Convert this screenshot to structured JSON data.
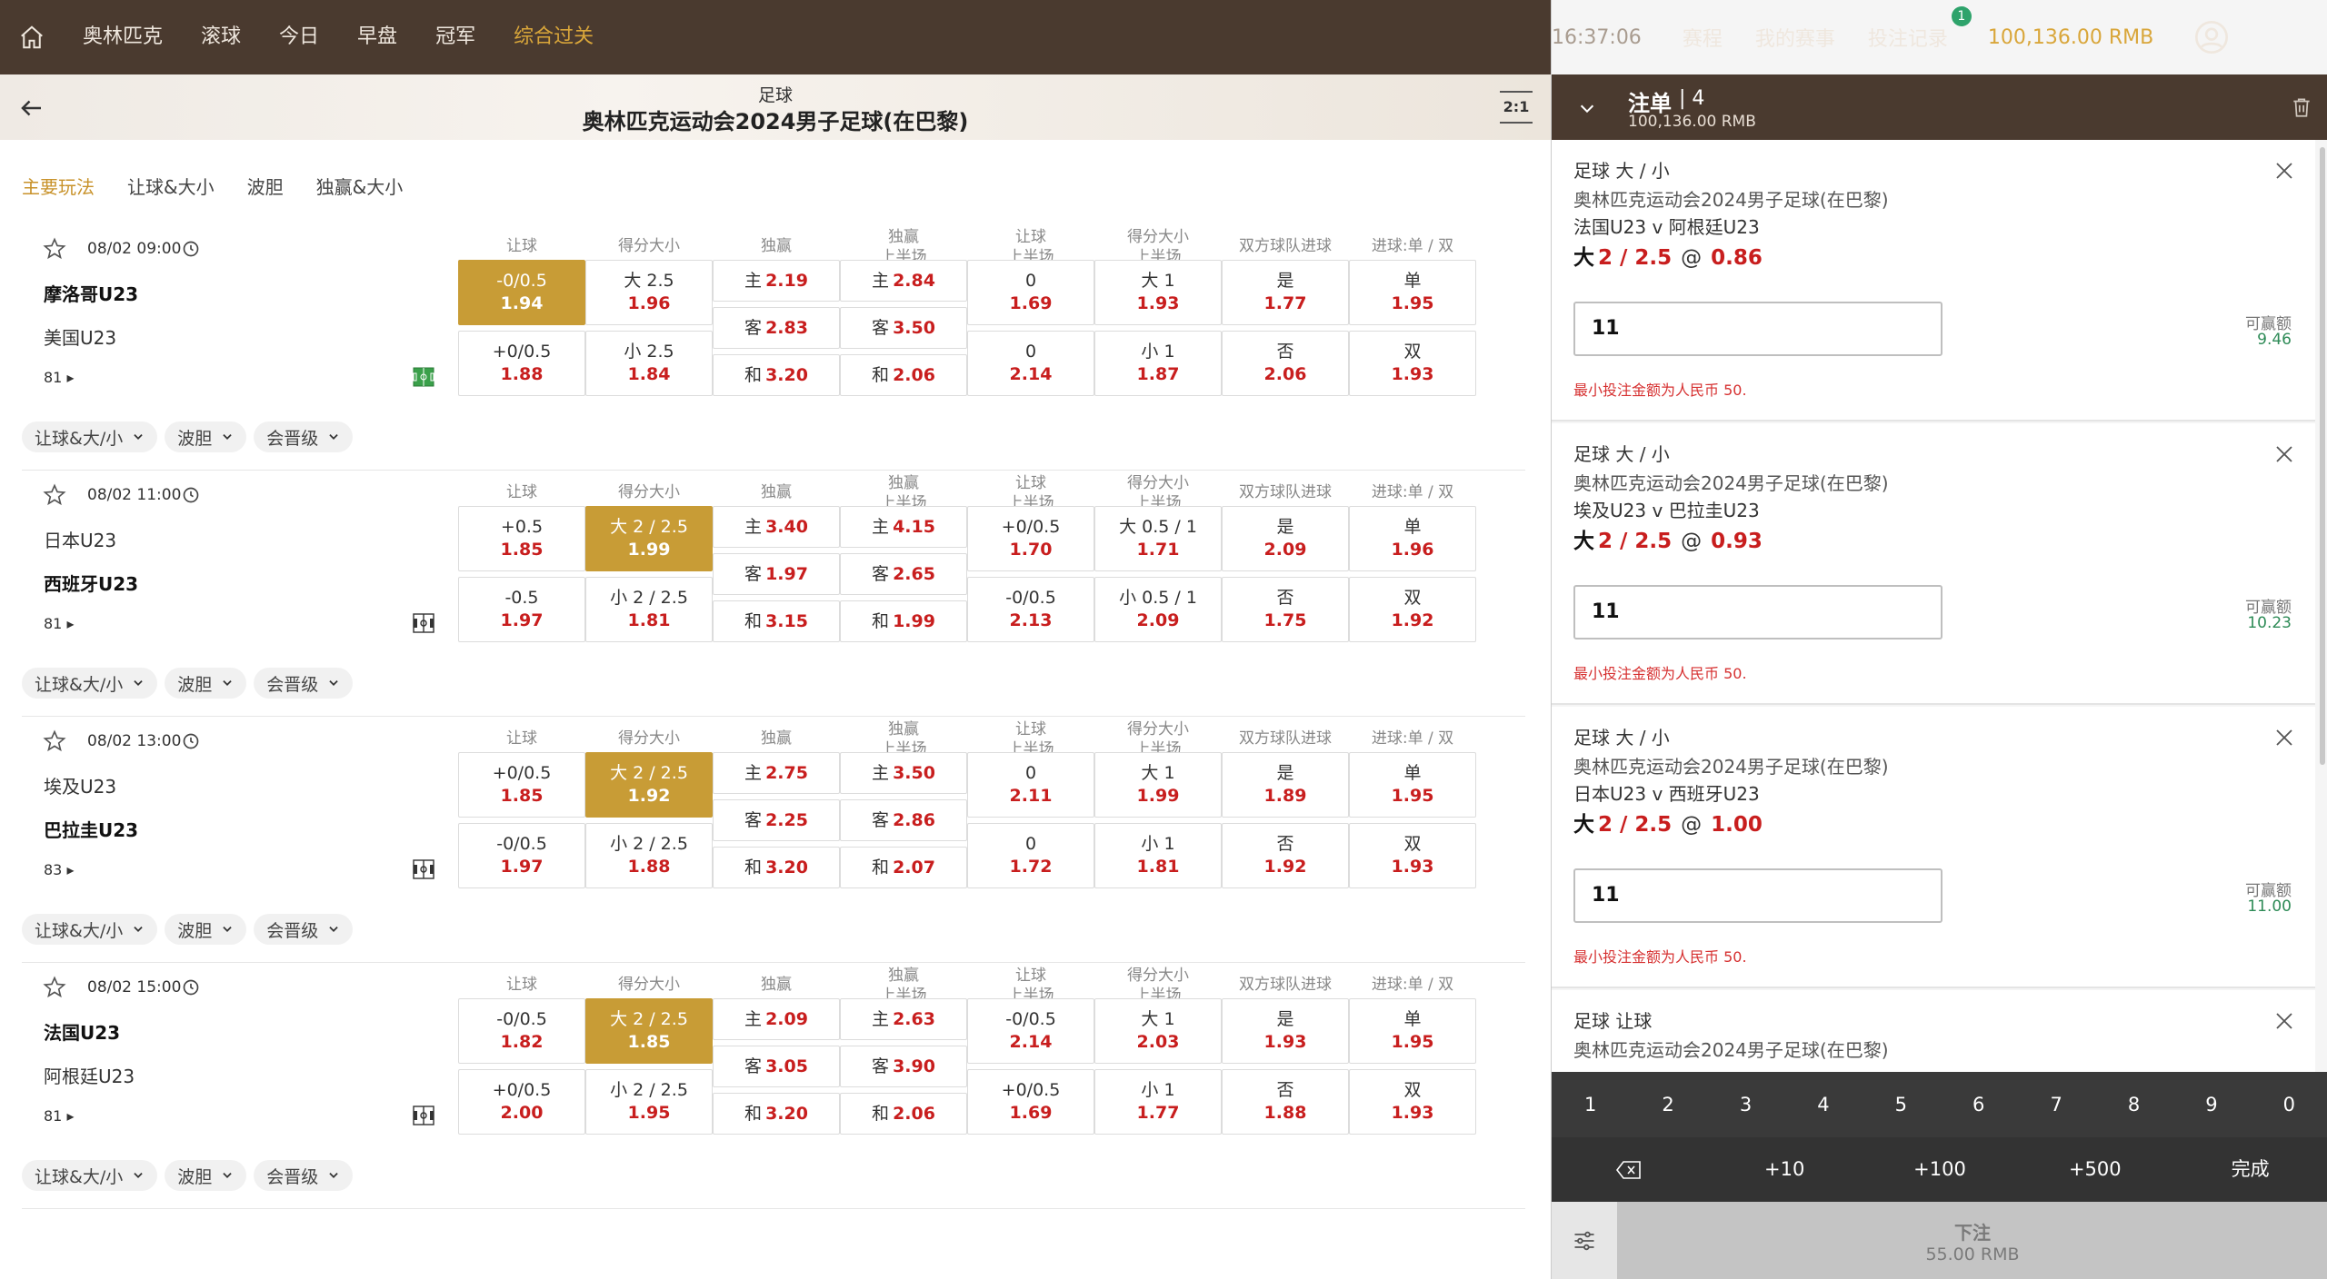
{
  "topnav": {
    "items": [
      "奥林匹克",
      "滚球",
      "今日",
      "早盘",
      "冠军",
      "综合过关"
    ],
    "active_index": 5,
    "clock": "16:37:06",
    "schedule": "赛程",
    "my_events": "我的赛事",
    "bet_history": "投注记录",
    "bet_history_badge": "1",
    "balance": "100,136.00 RMB"
  },
  "header": {
    "sport": "足球",
    "league": "奥林匹克运动会2024男子足球(在巴黎)",
    "score_icon": "2:1"
  },
  "tabs": [
    "主要玩法",
    "让球&大小",
    "波胆",
    "独赢&大小"
  ],
  "columns": [
    [
      "让球",
      ""
    ],
    [
      "得分大小",
      ""
    ],
    [
      "独赢",
      ""
    ],
    [
      "独赢",
      "上半场"
    ],
    [
      "让球",
      "上半场"
    ],
    [
      "得分大小",
      "上半场"
    ],
    [
      "双方球队进球",
      ""
    ],
    [
      "进球:单 / 双",
      ""
    ]
  ],
  "pills": [
    "让球&大/小",
    "波胆",
    "会晋级"
  ],
  "matches": [
    {
      "time": "08/02 09:00",
      "team1": "摩洛哥U23",
      "team2": "美国U23",
      "bold": 1,
      "mins": "81",
      "hdp": [
        [
          "-0/0.5",
          "1.94"
        ],
        [
          "+0/0.5",
          "1.88"
        ]
      ],
      "ou": [
        [
          "大 2.5",
          "1.96"
        ],
        [
          "小 2.5",
          "1.84"
        ]
      ],
      "x12": [
        [
          "主",
          "2.19"
        ],
        [
          "客",
          "2.83"
        ],
        [
          "和",
          "3.20"
        ]
      ],
      "x12h": [
        [
          "主",
          "2.84"
        ],
        [
          "客",
          "3.50"
        ],
        [
          "和",
          "2.06"
        ]
      ],
      "hdph": [
        [
          "0",
          "1.69"
        ],
        [
          "0",
          "2.14"
        ]
      ],
      "ouh": [
        [
          "大 1",
          "1.93"
        ],
        [
          "小 1",
          "1.87"
        ]
      ],
      "btts": [
        [
          "是",
          "1.77"
        ],
        [
          "否",
          "2.06"
        ]
      ],
      "oe": [
        [
          "单",
          "1.95"
        ],
        [
          "双",
          "1.93"
        ]
      ],
      "selected": "hdp0"
    },
    {
      "time": "08/02 11:00",
      "team1": "日本U23",
      "team2": "西班牙U23",
      "bold": 2,
      "mins": "81",
      "hdp": [
        [
          "+0.5",
          "1.85"
        ],
        [
          "-0.5",
          "1.97"
        ]
      ],
      "ou": [
        [
          "大 2 / 2.5",
          "1.99"
        ],
        [
          "小 2 / 2.5",
          "1.81"
        ]
      ],
      "x12": [
        [
          "主",
          "3.40"
        ],
        [
          "客",
          "1.97"
        ],
        [
          "和",
          "3.15"
        ]
      ],
      "x12h": [
        [
          "主",
          "4.15"
        ],
        [
          "客",
          "2.65"
        ],
        [
          "和",
          "1.99"
        ]
      ],
      "hdph": [
        [
          "+0/0.5",
          "1.70"
        ],
        [
          "-0/0.5",
          "2.13"
        ]
      ],
      "ouh": [
        [
          "大 0.5 / 1",
          "1.71"
        ],
        [
          "小 0.5 / 1",
          "2.09"
        ]
      ],
      "btts": [
        [
          "是",
          "2.09"
        ],
        [
          "否",
          "1.75"
        ]
      ],
      "oe": [
        [
          "单",
          "1.96"
        ],
        [
          "双",
          "1.92"
        ]
      ],
      "selected": "ou0"
    },
    {
      "time": "08/02 13:00",
      "team1": "埃及U23",
      "team2": "巴拉圭U23",
      "bold": 2,
      "mins": "83",
      "hdp": [
        [
          "+0/0.5",
          "1.85"
        ],
        [
          "-0/0.5",
          "1.97"
        ]
      ],
      "ou": [
        [
          "大 2 / 2.5",
          "1.92"
        ],
        [
          "小 2 / 2.5",
          "1.88"
        ]
      ],
      "x12": [
        [
          "主",
          "2.75"
        ],
        [
          "客",
          "2.25"
        ],
        [
          "和",
          "3.20"
        ]
      ],
      "x12h": [
        [
          "主",
          "3.50"
        ],
        [
          "客",
          "2.86"
        ],
        [
          "和",
          "2.07"
        ]
      ],
      "hdph": [
        [
          "0",
          "2.11"
        ],
        [
          "0",
          "1.72"
        ]
      ],
      "ouh": [
        [
          "大 1",
          "1.99"
        ],
        [
          "小 1",
          "1.81"
        ]
      ],
      "btts": [
        [
          "是",
          "1.89"
        ],
        [
          "否",
          "1.92"
        ]
      ],
      "oe": [
        [
          "单",
          "1.95"
        ],
        [
          "双",
          "1.93"
        ]
      ],
      "selected": "ou0"
    },
    {
      "time": "08/02 15:00",
      "team1": "法国U23",
      "team2": "阿根廷U23",
      "bold": 1,
      "mins": "81",
      "hdp": [
        [
          "-0/0.5",
          "1.82"
        ],
        [
          "+0/0.5",
          "2.00"
        ]
      ],
      "ou": [
        [
          "大 2 / 2.5",
          "1.85"
        ],
        [
          "小 2 / 2.5",
          "1.95"
        ]
      ],
      "x12": [
        [
          "主",
          "2.09"
        ],
        [
          "客",
          "3.05"
        ],
        [
          "和",
          "3.20"
        ]
      ],
      "x12h": [
        [
          "主",
          "2.63"
        ],
        [
          "客",
          "3.90"
        ],
        [
          "和",
          "2.06"
        ]
      ],
      "hdph": [
        [
          "-0/0.5",
          "2.14"
        ],
        [
          "+0/0.5",
          "1.69"
        ]
      ],
      "ouh": [
        [
          "大 1",
          "2.03"
        ],
        [
          "小 1",
          "1.77"
        ]
      ],
      "btts": [
        [
          "是",
          "1.93"
        ],
        [
          "否",
          "1.88"
        ]
      ],
      "oe": [
        [
          "单",
          "1.95"
        ],
        [
          "双",
          "1.93"
        ]
      ],
      "selected": "ou0"
    }
  ],
  "betslip": {
    "title": "注单",
    "count": "4",
    "balance": "100,136.00 RMB",
    "win_label": "可赢额",
    "min_warning": "最小投注金额为人民币 50.",
    "slips": [
      {
        "type": "足球 大 / 小",
        "comp": "奥林匹克运动会2024男子足球(在巴黎)",
        "teams": "法国U23 v 阿根廷U23",
        "pick": "大",
        "line": "2 / 2.5",
        "at": "@",
        "odds": "0.86",
        "stake": "11",
        "win": "9.46"
      },
      {
        "type": "足球 大 / 小",
        "comp": "奥林匹克运动会2024男子足球(在巴黎)",
        "teams": "埃及U23 v 巴拉圭U23",
        "pick": "大",
        "line": "2 / 2.5",
        "at": "@",
        "odds": "0.93",
        "stake": "11",
        "win": "10.23"
      },
      {
        "type": "足球 大 / 小",
        "comp": "奥林匹克运动会2024男子足球(在巴黎)",
        "teams": "日本U23 v 西班牙U23",
        "pick": "大",
        "line": "2 / 2.5",
        "at": "@",
        "odds": "1.00",
        "stake": "11",
        "win": "11.00"
      },
      {
        "type": "足球 让球",
        "comp": "奥林匹克运动会2024男子足球(在巴黎)",
        "teams": "",
        "pick": "",
        "line": "",
        "at": "",
        "odds": "",
        "stake": "",
        "win": ""
      }
    ]
  },
  "keypad": {
    "digits": [
      "1",
      "2",
      "3",
      "4",
      "5",
      "6",
      "7",
      "8",
      "9",
      "0"
    ],
    "quick": [
      "+10",
      "+100",
      "+500"
    ],
    "done": "完成"
  },
  "place_bet": {
    "label": "下注",
    "amount": "55.00 RMB"
  },
  "colors": {
    "topbar": "#4a3a2f",
    "accent": "#c89c36",
    "odds_red": "#c81e1e",
    "win_green": "#2e8b57"
  }
}
